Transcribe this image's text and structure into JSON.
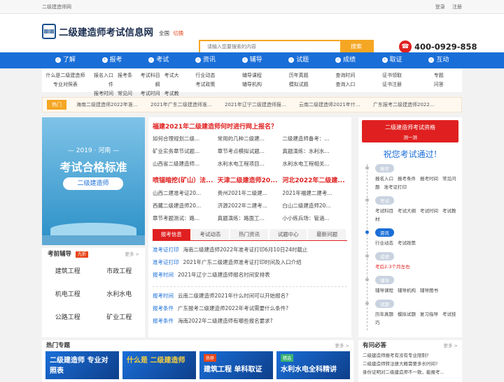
{
  "topbar": {
    "site": "二级建造师网",
    "login": "登录",
    "register": "注册"
  },
  "header": {
    "logo_mark": "ⅢⅢ",
    "logo_text": "二级建造师考试信息网",
    "region": "全国",
    "switch": "切换",
    "search_placeholder": "请输入您要搜索的内容",
    "search_btn": "搜索",
    "phone": "400-0929-858"
  },
  "nav": [
    {
      "label": "了解"
    },
    {
      "label": "报考"
    },
    {
      "label": "考试"
    },
    {
      "label": "资讯"
    },
    {
      "label": "辅导"
    },
    {
      "label": "试题"
    },
    {
      "label": "成绩"
    },
    {
      "label": "取证"
    },
    {
      "label": "互动"
    }
  ],
  "submenu": [
    [
      [
        "什么是二级建造师"
      ],
      [
        "专业对照表"
      ]
    ],
    [
      [
        "报名入口",
        "报考条件"
      ],
      [
        "报考时间",
        "常见问题"
      ]
    ],
    [
      [
        "考试科目",
        "考试大纲"
      ],
      [
        "考试时间",
        "考试教材"
      ]
    ],
    [
      [
        "行业动态"
      ],
      [
        "考试政策"
      ]
    ],
    [
      [
        "辅导课程"
      ],
      [
        "辅导机构"
      ]
    ],
    [
      [
        "历年真题"
      ],
      [
        "模拟试题"
      ]
    ],
    [
      [
        "查询时间"
      ],
      [
        "查询入口"
      ]
    ],
    [
      [
        "证书领取"
      ],
      [
        "证书注册"
      ]
    ],
    [
      [
        "专题"
      ],
      [
        "问答"
      ]
    ]
  ],
  "hot": {
    "tag": "热门",
    "items": [
      "海南二级建造师2022年准...",
      "2021年广东二级建造师准...",
      "2021年辽宁二级建造师报...",
      "云南二级建造师2021年什...",
      "广东报考二级建造师2022..."
    ]
  },
  "banner": {
    "year": "— 2019 · 河南 —",
    "title": "考试合格标准",
    "pill": "二级建造师"
  },
  "coach": {
    "title": "考前辅导",
    "new": "九折",
    "more": "更多 >",
    "items": [
      "建筑工程",
      "市政工程",
      "机电工程",
      "水利水电",
      "公路工程",
      "矿业工程"
    ]
  },
  "news": {
    "headline1": "福建2021年二级建造师何时进行网上报名？",
    "rows1": [
      [
        "如何合理规划二级...",
        "常用的几种二级建...",
        "二级建造师备考：..."
      ],
      [
        "矿业实务章节试题...",
        "章节考点模拟试题...",
        "真题演练：水利水..."
      ],
      [
        "山西省二级建造师...",
        "水利水电工程项目...",
        "水利水电工程相关..."
      ]
    ],
    "headline2": [
      "喷锚暗挖(矿山）法...",
      "天津二级建造师20...",
      "河北2022年二级建..."
    ],
    "rows2": [
      [
        "山西二建准考证20...",
        "贵州2021年二级建...",
        "2021年福建二建考..."
      ],
      [
        "西藏二级建造师20...",
        "济源2022年二建考...",
        "白山二级建造师20..."
      ],
      [
        "章节考题测试：路...",
        "真题演练：路面工...",
        "小小练兵场：管涵..."
      ]
    ],
    "tabs": [
      "报考信息",
      "考试动态",
      "热门资讯",
      "试题中心",
      "最新问题"
    ],
    "list1": [
      {
        "cat": "准考证打印",
        "text": "海南二级建造师2022年准考证打印6月10日24时截止"
      },
      {
        "cat": "准考证打印",
        "text": "2021年广东二级建造师准考证打印时间及入口介绍"
      },
      {
        "cat": "报考时间",
        "text": "2021年辽宁二级建造师报名时间安排表"
      }
    ],
    "list2": [
      {
        "cat": "报考时间",
        "text": "云南二级建造师2021年什么时间可以开始报名?"
      },
      {
        "cat": "报考条件",
        "text": "广东报考二级建造师2022年考试需要什么条件?"
      },
      {
        "cat": "报考条件",
        "text": "海南2022年二级建造师有哪些报名要求?"
      }
    ]
  },
  "side": {
    "btn_title": "二级建造师考试资格",
    "btn_sub": "测一测",
    "wish": "祝您考试通过!",
    "steps": [
      {
        "label": "报考",
        "subs": [
          "报名入口",
          "报考条件",
          "报考时间",
          "常见问题",
          "准考证打印"
        ],
        "on": false
      },
      {
        "label": "考试",
        "subs": [
          "考试科目",
          "考试大纲",
          "考试时间",
          "考试教材"
        ],
        "on": false
      },
      {
        "label": "资讯",
        "subs": [
          "行业动态",
          "考试政策"
        ],
        "on": true
      },
      {
        "label": "成绩",
        "subs": [
          "考后2-3个月左右"
        ],
        "on": false
      },
      {
        "label": "辅导",
        "subs": [
          "辅导课程",
          "辅导机构",
          "辅导图书"
        ],
        "on": false
      },
      {
        "label": "试题",
        "subs": [
          "历年真题",
          "模拟试题",
          "复习指导",
          "考试技巧"
        ],
        "on": false
      }
    ]
  },
  "topics": {
    "title": "热门专题",
    "more": "更多 >",
    "cards": [
      {
        "label": "",
        "title": "二级建造师 专业对照表"
      },
      {
        "label": "",
        "title": "什么是 二级建造师"
      },
      {
        "label": "热荐",
        "title": "建筑工程 单科取证"
      },
      {
        "label": "精选",
        "title": "水利水电全科精讲"
      }
    ]
  },
  "faq": {
    "title": "有问必答",
    "more": "更多 >",
    "items": [
      "二级建造师报考有没有专业限制?",
      "二级建造师转注册大概需要多长时间?",
      "身份证明对二级建造师不一致，能报考..."
    ]
  }
}
